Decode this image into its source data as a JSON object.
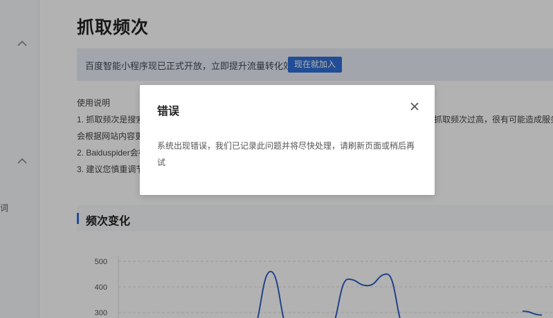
{
  "sidebar": {
    "partial_text": "词"
  },
  "page": {
    "title": "抓取频次"
  },
  "banner": {
    "text": "百度智能小程序现已正式开放，立即提升流量转化效率",
    "button_label": "现在就加入"
  },
  "usage": {
    "heading": "使用说明",
    "lines": [
      "1. 抓取频次是搜索",
      "会根据网站内容更",
      "2. Baiduspider会根",
      "3. 建议您慎重调节"
    ],
    "right_fragment": "抓取频次过高，很有可能造成服务"
  },
  "section": {
    "title": "频次变化"
  },
  "chart_data": {
    "type": "line",
    "title": "",
    "xlabel": "",
    "ylabel": "",
    "y_ticks": [
      "500",
      "400",
      "300"
    ],
    "ylim": [
      300,
      500
    ],
    "grid": true,
    "series": [
      {
        "color": "#2f5fc4",
        "x": [
          0,
          1,
          2,
          3,
          4,
          5,
          6,
          7,
          8,
          9,
          10,
          11,
          12,
          13,
          14,
          15,
          16,
          17,
          18,
          19,
          20
        ],
        "values": [
          null,
          null,
          null,
          null,
          230,
          460,
          230,
          null,
          235,
          430,
          405,
          450,
          235,
          null,
          null,
          null,
          null,
          null,
          305,
          290,
          null
        ]
      }
    ]
  },
  "modal": {
    "title": "错误",
    "message": "系统出现错误，我们已记录此问题并将尽快处理，请刷新页面或稍后再试",
    "close_icon": "close-icon"
  },
  "colors": {
    "accent": "#2f6fd6",
    "overlay": "rgba(0,0,0,0.30)",
    "banner_bg": "#e8edf7"
  }
}
